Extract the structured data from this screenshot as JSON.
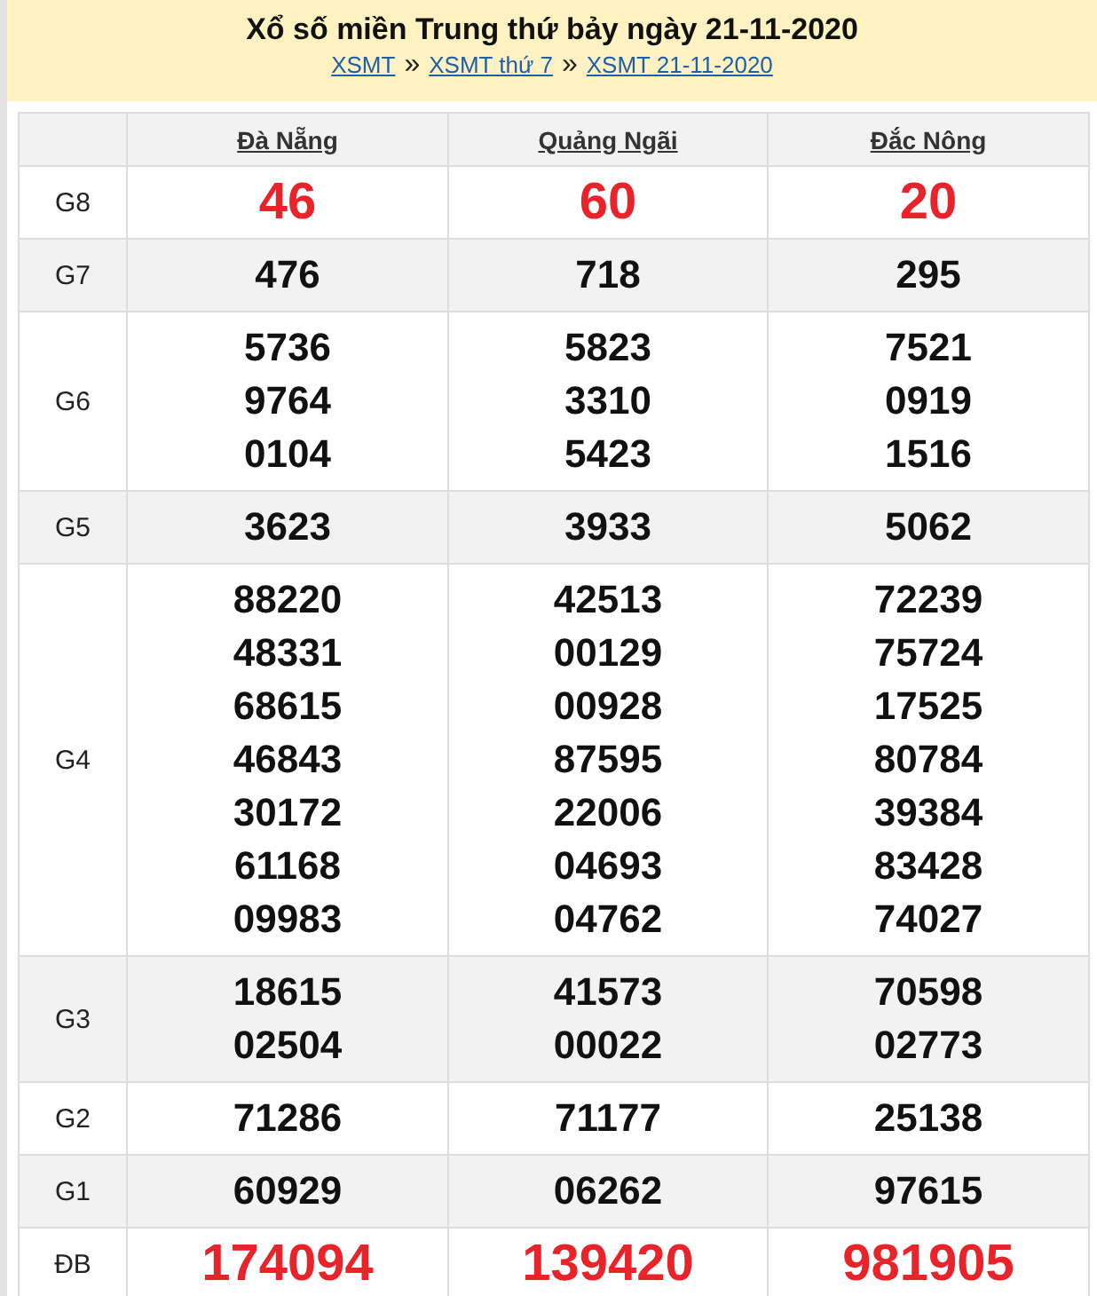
{
  "header": {
    "title": "Xổ số miền Trung thứ bảy ngày 21-11-2020",
    "breadcrumb": [
      {
        "label": "XSMT"
      },
      {
        "label": "XSMT thứ 7"
      },
      {
        "label": "XSMT 21-11-2020"
      }
    ],
    "separator": "»"
  },
  "table": {
    "columns": [
      "Đà Nẵng",
      "Quảng Ngãi",
      "Đắc Nông"
    ],
    "rows": [
      {
        "prize": "G8",
        "highlight": true,
        "cells": [
          [
            "46"
          ],
          [
            "60"
          ],
          [
            "20"
          ]
        ]
      },
      {
        "prize": "G7",
        "highlight": false,
        "cells": [
          [
            "476"
          ],
          [
            "718"
          ],
          [
            "295"
          ]
        ]
      },
      {
        "prize": "G6",
        "highlight": false,
        "cells": [
          [
            "5736",
            "9764",
            "0104"
          ],
          [
            "5823",
            "3310",
            "5423"
          ],
          [
            "7521",
            "0919",
            "1516"
          ]
        ]
      },
      {
        "prize": "G5",
        "highlight": false,
        "cells": [
          [
            "3623"
          ],
          [
            "3933"
          ],
          [
            "5062"
          ]
        ]
      },
      {
        "prize": "G4",
        "highlight": false,
        "cells": [
          [
            "88220",
            "48331",
            "68615",
            "46843",
            "30172",
            "61168",
            "09983"
          ],
          [
            "42513",
            "00129",
            "00928",
            "87595",
            "22006",
            "04693",
            "04762"
          ],
          [
            "72239",
            "75724",
            "17525",
            "80784",
            "39384",
            "83428",
            "74027"
          ]
        ]
      },
      {
        "prize": "G3",
        "highlight": false,
        "cells": [
          [
            "18615",
            "02504"
          ],
          [
            "41573",
            "00022"
          ],
          [
            "70598",
            "02773"
          ]
        ]
      },
      {
        "prize": "G2",
        "highlight": false,
        "cells": [
          [
            "71286"
          ],
          [
            "71177"
          ],
          [
            "25138"
          ]
        ]
      },
      {
        "prize": "G1",
        "highlight": false,
        "cells": [
          [
            "60929"
          ],
          [
            "06262"
          ],
          [
            "97615"
          ]
        ]
      },
      {
        "prize": "ĐB",
        "highlight": true,
        "cells": [
          [
            "174094"
          ],
          [
            "139420"
          ],
          [
            "981905"
          ]
        ]
      }
    ]
  }
}
